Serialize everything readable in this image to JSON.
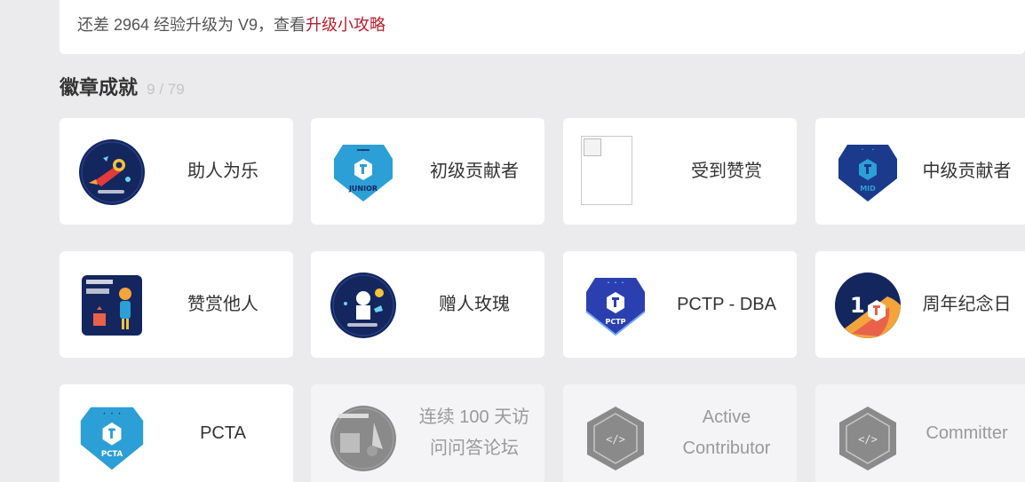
{
  "notice": {
    "text": "还差 2964 经验升级为 V9，查看",
    "link": "升级小攻略"
  },
  "badges_section": {
    "title": "徽章成就",
    "count": "9 / 79",
    "items": [
      {
        "label": "助人为乐",
        "icon": "helper-rocket-icon"
      },
      {
        "label": "初级贡献者",
        "icon": "junior-shield-icon"
      },
      {
        "label": "受到赞赏",
        "icon": "broken-image-icon"
      },
      {
        "label": "中级贡献者",
        "icon": "mid-shield-icon"
      },
      {
        "label": "赞赏他人",
        "icon": "appreciate-others-icon"
      },
      {
        "label": "赠人玫瑰",
        "icon": "rose-gift-icon"
      },
      {
        "label": "PCTP - DBA",
        "icon": "pctp-shield-icon"
      },
      {
        "label": "周年纪念日",
        "icon": "anniversary-icon"
      },
      {
        "label": "PCTA",
        "icon": "pcta-shield-icon"
      },
      {
        "label": "连续 100 天访问问答论坛",
        "icon": "visit-100-days-icon"
      },
      {
        "label": "Active Contributor",
        "icon": "active-contributor-hex-icon"
      },
      {
        "label": "Committer",
        "icon": "committer-hex-icon"
      }
    ],
    "badge_texts": {
      "junior": "JUNIOR",
      "mid": "MID",
      "pctp": "PCTP",
      "pcta": "PCTA",
      "anniversary_number": "1"
    }
  },
  "colors": {
    "link": "#b41e2b",
    "junior_shield": "#2c9fd6",
    "mid_shield": "#1b3a8c",
    "pctp_shield": "#2c3fb0",
    "locked_badge": "#8a8a8a"
  }
}
